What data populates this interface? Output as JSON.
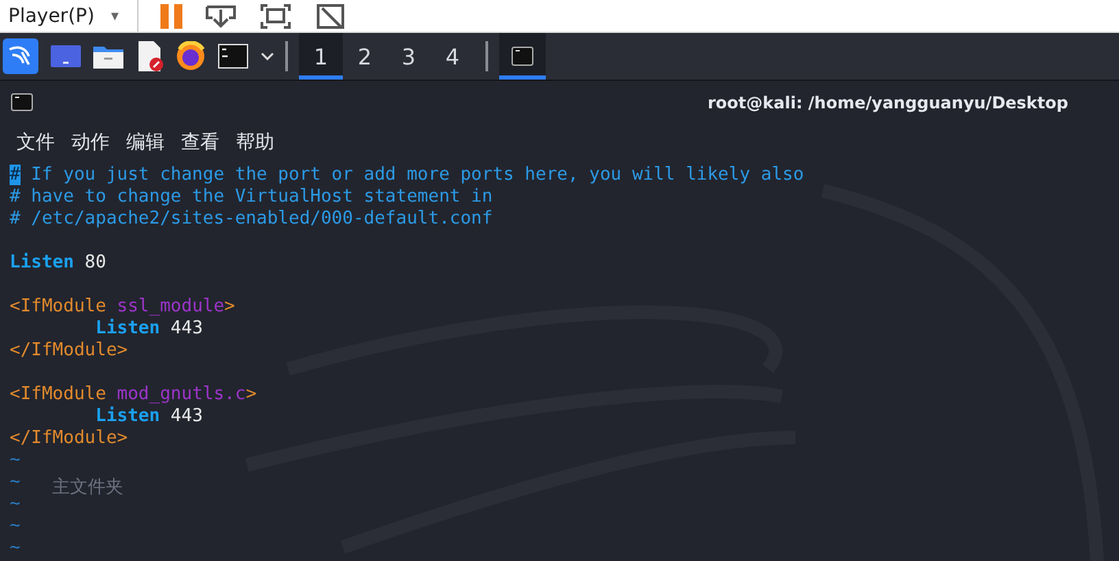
{
  "host_bar": {
    "menu_label": "Player(P)",
    "menu_caret": "▾"
  },
  "taskbar": {
    "workspaces": [
      {
        "label": "1",
        "selected": true
      },
      {
        "label": "2",
        "selected": false
      },
      {
        "label": "3",
        "selected": false
      },
      {
        "label": "4",
        "selected": false
      }
    ],
    "tasks": [
      {
        "selected": true
      }
    ]
  },
  "window": {
    "title": "root@kali: /home/yangguanyu/Desktop"
  },
  "menu": [
    "文件",
    "动作",
    "编辑",
    "查看",
    "帮助"
  ],
  "desktop_behind": {
    "label": "主文件夹"
  },
  "editor": {
    "lines": [
      {
        "kind": "code",
        "indented": false,
        "segments": [
          {
            "kind": "cursor",
            "text": "#"
          },
          {
            "kind": "comment",
            "text": " If you just change the port or add more ports here, you will likely also"
          }
        ]
      },
      {
        "kind": "code",
        "indented": false,
        "segments": [
          {
            "kind": "comment",
            "text": "# have to change the VirtualHost statement in"
          }
        ]
      },
      {
        "kind": "code",
        "indented": false,
        "segments": [
          {
            "kind": "comment",
            "text": "# /etc/apache2/sites-enabled/000-default.conf"
          }
        ]
      },
      {
        "kind": "blank"
      },
      {
        "kind": "code",
        "indented": false,
        "segments": [
          {
            "kind": "keyword",
            "text": "Listen"
          },
          {
            "kind": "plain",
            "text": " 80"
          }
        ]
      },
      {
        "kind": "blank"
      },
      {
        "kind": "code",
        "indented": false,
        "segments": [
          {
            "kind": "tag",
            "text": "<IfModule"
          },
          {
            "kind": "attr",
            "text": " ssl_module"
          },
          {
            "kind": "tag",
            "text": ">"
          }
        ]
      },
      {
        "kind": "code",
        "indented": true,
        "segments": [
          {
            "kind": "keyword",
            "text": "Listen"
          },
          {
            "kind": "plain",
            "text": " 443"
          }
        ]
      },
      {
        "kind": "code",
        "indented": false,
        "segments": [
          {
            "kind": "tag",
            "text": "</IfModule>"
          }
        ]
      },
      {
        "kind": "blank"
      },
      {
        "kind": "code",
        "indented": false,
        "segments": [
          {
            "kind": "tag",
            "text": "<IfModule"
          },
          {
            "kind": "attr",
            "text": " mod_gnutls.c"
          },
          {
            "kind": "tag",
            "text": ">"
          }
        ]
      },
      {
        "kind": "code",
        "indented": true,
        "segments": [
          {
            "kind": "keyword",
            "text": "Listen"
          },
          {
            "kind": "plain",
            "text": " 443"
          }
        ]
      },
      {
        "kind": "code",
        "indented": false,
        "segments": [
          {
            "kind": "tag",
            "text": "</IfModule>"
          }
        ]
      },
      {
        "kind": "tilde",
        "text": "~"
      },
      {
        "kind": "tilde",
        "text": "~"
      },
      {
        "kind": "tilde",
        "text": "~"
      },
      {
        "kind": "tilde",
        "text": "~"
      },
      {
        "kind": "tilde",
        "text": "~"
      }
    ]
  }
}
